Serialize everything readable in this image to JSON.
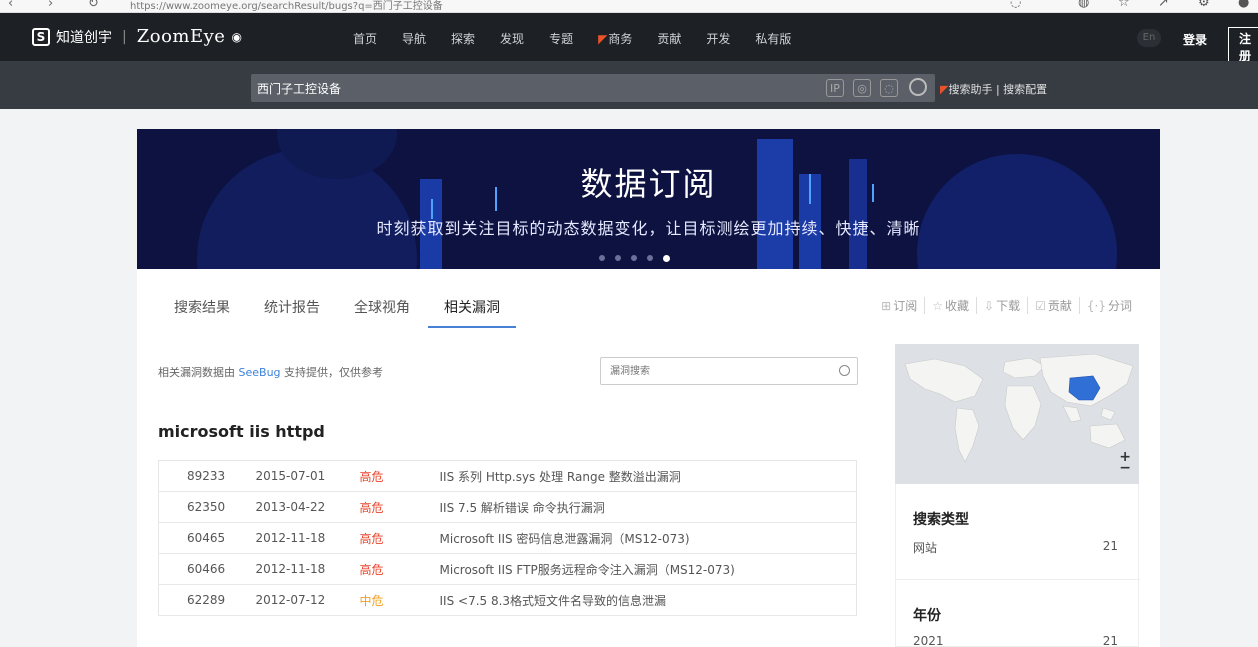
{
  "browser": {
    "url": "https://www.zoomeye.org/searchResult/bugs?q=西门子工控设备"
  },
  "header": {
    "brand": "知道创宇",
    "product": "ZoomEye",
    "menu": [
      "首页",
      "导航",
      "探索",
      "发现",
      "专题",
      "商务",
      "贡献",
      "开发",
      "私有版"
    ],
    "lang": "En",
    "login": "登录",
    "register": "注册"
  },
  "search": {
    "query": "西门子工控设备",
    "assistant": "搜索助手",
    "config": "搜索配置"
  },
  "banner": {
    "title": "数据订阅",
    "subtitle": "时刻获取到关注目标的动态数据变化，让目标测绘更加持续、快捷、清晰",
    "slides": 5,
    "active_slide": 5
  },
  "tabs": [
    {
      "label": "搜索结果",
      "active": false
    },
    {
      "label": "统计报告",
      "active": false
    },
    {
      "label": "全球视角",
      "active": false
    },
    {
      "label": "相关漏洞",
      "active": true
    }
  ],
  "actions": [
    {
      "label": "订阅",
      "icon": "subscribe-icon"
    },
    {
      "label": "收藏",
      "icon": "star-icon"
    },
    {
      "label": "下载",
      "icon": "download-icon"
    },
    {
      "label": "贡献",
      "icon": "contribute-icon"
    },
    {
      "label": "分词",
      "icon": "code-braces-icon"
    }
  ],
  "note": {
    "prefix": "相关漏洞数据由",
    "source": "SeeBug",
    "suffix": "支持提供，仅供参考"
  },
  "vuln_search": {
    "placeholder": "漏洞搜索"
  },
  "product_title": "microsoft iis httpd",
  "vulns": [
    {
      "id": "89233",
      "date": "2015-07-01",
      "level": "高危",
      "title": "IIS 系列 Http.sys 处理 Range 整数溢出漏洞"
    },
    {
      "id": "62350",
      "date": "2013-04-22",
      "level": "高危",
      "title": "IIS 7.5 解析错误 命令执行漏洞"
    },
    {
      "id": "60465",
      "date": "2012-11-18",
      "level": "高危",
      "title": "Microsoft IIS 密码信息泄露漏洞（MS12-073)"
    },
    {
      "id": "60466",
      "date": "2012-11-18",
      "level": "高危",
      "title": "Microsoft IIS FTP服务远程命令注入漏洞（MS12-073)"
    },
    {
      "id": "62289",
      "date": "2012-07-12",
      "level": "中危",
      "title": "IIS <7.5 8.3格式短文件名导致的信息泄漏"
    }
  ],
  "sidebar": {
    "search_type_title": "搜索类型",
    "search_type_label": "网站",
    "search_type_count": "21",
    "year_title": "年份",
    "year_label": "2021",
    "year_count": "21"
  },
  "colors": {
    "nav_bg": "#1d2126",
    "search_bg": "#373c43",
    "accent": "#4a7fd6",
    "high": "#e8432b",
    "medium": "#f0a020",
    "map_highlight": "#2f6fd6"
  }
}
